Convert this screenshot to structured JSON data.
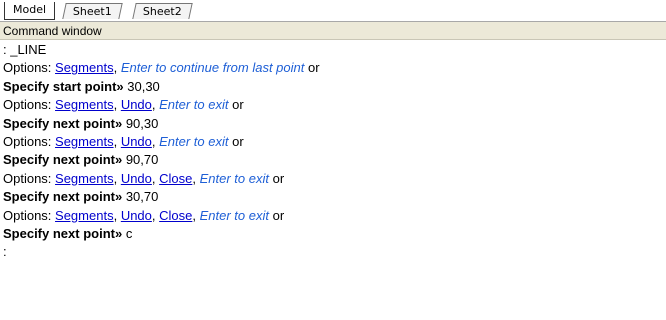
{
  "tabs": [
    {
      "label": "Model",
      "active": true
    },
    {
      "label": "Sheet1",
      "active": false
    },
    {
      "label": "Sheet2",
      "active": false
    }
  ],
  "command_window": {
    "title": "Command window",
    "lines": [
      {
        "kind": "plain",
        "text": ": _LINE"
      },
      {
        "kind": "options",
        "prefix": "Options: ",
        "items": [
          "Segments",
          ", "
        ],
        "italic": "Enter to continue from last point",
        "suffix": " or"
      },
      {
        "kind": "prompt",
        "label": "Specify start point»",
        "value": " 30,30"
      },
      {
        "kind": "options",
        "prefix": "Options: ",
        "items": [
          "Segments",
          ", ",
          "Undo",
          ", "
        ],
        "italic": "Enter to exit",
        "suffix": " or"
      },
      {
        "kind": "prompt",
        "label": "Specify next point»",
        "value": " 90,30"
      },
      {
        "kind": "options",
        "prefix": "Options: ",
        "items": [
          "Segments",
          ", ",
          "Undo",
          ", "
        ],
        "italic": "Enter to exit",
        "suffix": " or"
      },
      {
        "kind": "prompt",
        "label": "Specify next point»",
        "value": " 90,70"
      },
      {
        "kind": "options",
        "prefix": "Options: ",
        "items": [
          "Segments",
          ", ",
          "Undo",
          ", ",
          "Close",
          ", "
        ],
        "italic": "Enter to exit",
        "suffix": " or"
      },
      {
        "kind": "prompt",
        "label": "Specify next point»",
        "value": " 30,70"
      },
      {
        "kind": "options",
        "prefix": "Options: ",
        "items": [
          "Segments",
          ", ",
          "Undo",
          ", ",
          "Close",
          ", "
        ],
        "italic": "Enter to exit",
        "suffix": " or"
      },
      {
        "kind": "prompt",
        "label": "Specify next point»",
        "value": " c"
      },
      {
        "kind": "plain",
        "text": ":"
      }
    ]
  }
}
